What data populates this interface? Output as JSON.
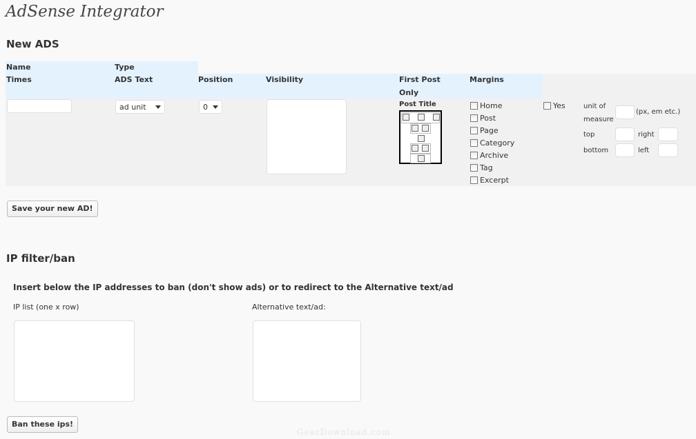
{
  "page": {
    "title": "AdSense Integrator"
  },
  "new_ads": {
    "heading": "New ADS",
    "headers": {
      "name": "Name",
      "type": "Type",
      "times": "Times",
      "ads_text": "ADS Text",
      "position": "Position",
      "visibility": "Visibility",
      "first_post_only_line1": "First Post",
      "first_post_only_line2": "Only",
      "margins": "Margins"
    },
    "name_value": "",
    "type_select": "ad unit",
    "position_select": "0",
    "post_title_label": "Post Title",
    "visibility_options": [
      "Home",
      "Post",
      "Page",
      "Category",
      "Archive",
      "Tag",
      "Excerpt"
    ],
    "first_post_only_option": "Yes",
    "margins": {
      "unit_label_line1": "unit of",
      "unit_label_line2": "measure",
      "unit_hint": "(px, em etc.)",
      "top": "top",
      "right": "right",
      "bottom": "bottom",
      "left": "left"
    },
    "save_button": "Save your new AD!"
  },
  "ip_filter": {
    "heading": "IP filter/ban",
    "instructions": "Insert below the IP addresses to ban (don't show ads) or to redirect to the Alternative text/ad",
    "ip_list_label": "IP list (one x row)",
    "alt_text_label": "Alternative text/ad:",
    "ban_button": "Ban these ips!"
  },
  "watermark": "GearDownload.com"
}
